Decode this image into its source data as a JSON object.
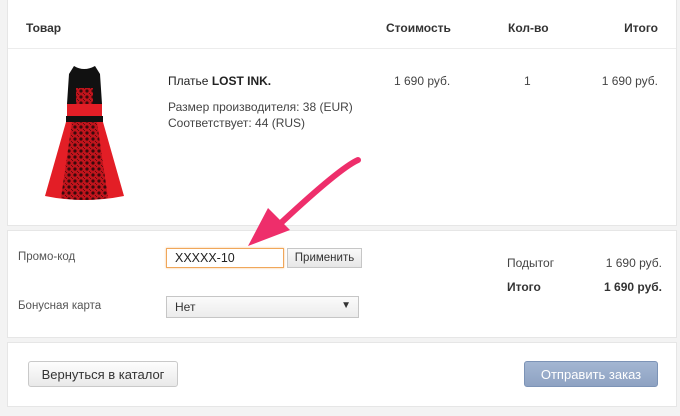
{
  "header": {
    "product": "Товар",
    "cost": "Стоимость",
    "quantity": "Кол-во",
    "total": "Итого"
  },
  "item": {
    "name_prefix": "Платье",
    "name_brand": "LOST INK.",
    "size_line": "Размер производителя: 38 (EUR)",
    "match_line": "Соответствует: 44 (RUS)",
    "price": "1 690 руб.",
    "qty": "1",
    "total": "1 690 руб."
  },
  "promo": {
    "label": "Промо-код",
    "value": "XXXXX-10",
    "apply_label": "Применить"
  },
  "bonus": {
    "label": "Бонусная карта",
    "selected": "Нет"
  },
  "summary": {
    "subtotal_label": "Подытог",
    "subtotal_value": "1 690 руб.",
    "total_label": "Итого",
    "total_value": "1 690 руб."
  },
  "footer": {
    "back_label": "Вернуться в каталог",
    "submit_label": "Отправить заказ"
  },
  "colors": {
    "annotation_arrow": "#ee2e6b",
    "submit_button": "#8ea2c2",
    "input_focus": "#f0a75a"
  }
}
